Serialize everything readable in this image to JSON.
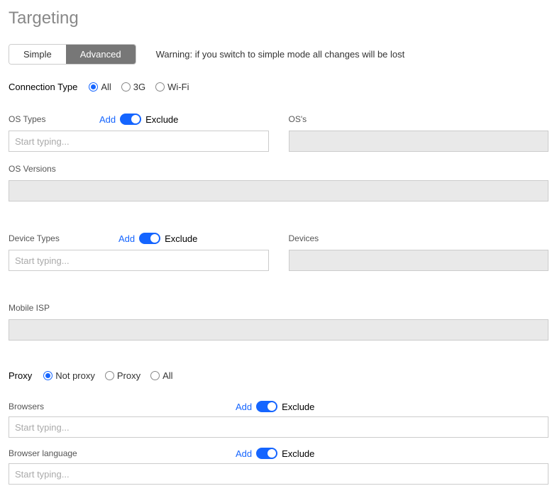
{
  "title": "Targeting",
  "mode": {
    "simple": "Simple",
    "advanced": "Advanced"
  },
  "warning": "Warning: if you switch to simple mode all changes will be lost",
  "connection": {
    "label": "Connection Type",
    "options": {
      "all": "All",
      "g3": "3G",
      "wifi": "Wi-Fi"
    }
  },
  "inputs": {
    "placeholder": "Start typing..."
  },
  "controls": {
    "add": "Add",
    "exclude": "Exclude"
  },
  "labels": {
    "os_types": "OS Types",
    "oss": "OS's",
    "os_versions": "OS Versions",
    "device_types": "Device Types",
    "devices": "Devices",
    "mobile_isp": "Mobile ISP",
    "browsers": "Browsers",
    "browser_language": "Browser language"
  },
  "proxy": {
    "label": "Proxy",
    "options": {
      "not_proxy": "Not proxy",
      "proxy": "Proxy",
      "all": "All"
    }
  }
}
